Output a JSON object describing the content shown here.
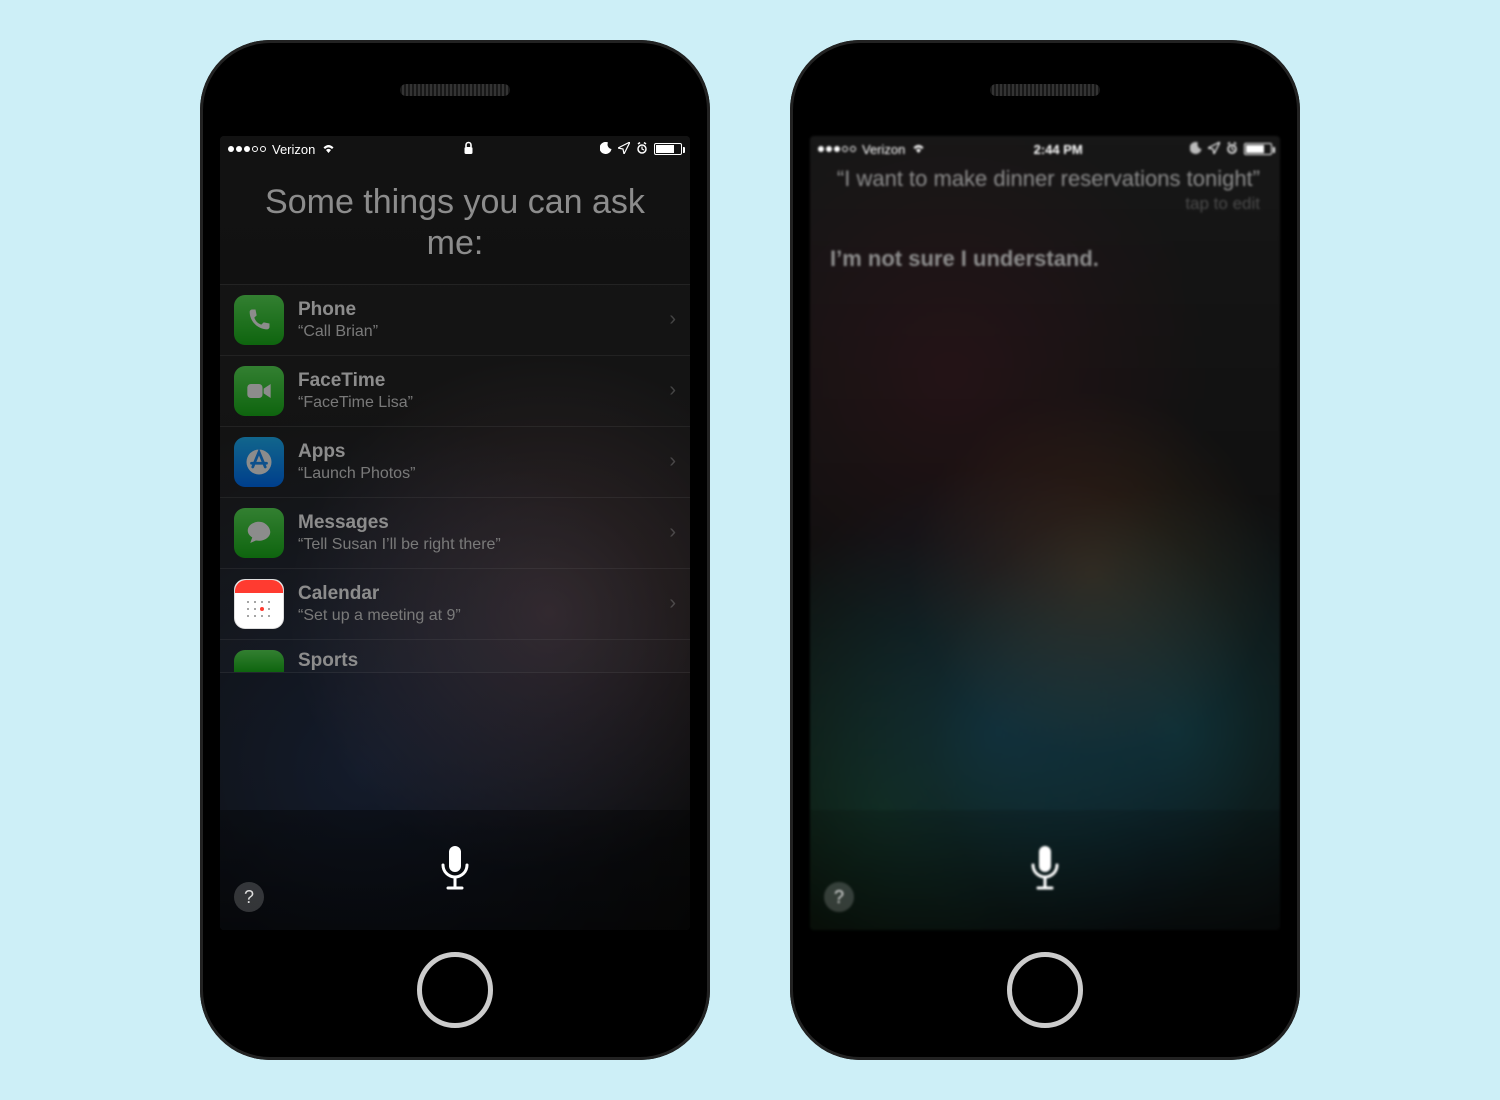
{
  "phone1": {
    "status": {
      "carrier": "Verizon",
      "time": ""
    },
    "title": "Some things you can ask me:",
    "items": [
      {
        "icon": "phone",
        "title": "Phone",
        "example": "“Call Brian”"
      },
      {
        "icon": "facetime",
        "title": "FaceTime",
        "example": "“FaceTime Lisa”"
      },
      {
        "icon": "apps",
        "title": "Apps",
        "example": "“Launch Photos”"
      },
      {
        "icon": "messages",
        "title": "Messages",
        "example": "“Tell Susan I’ll be right there”"
      },
      {
        "icon": "calendar",
        "title": "Calendar",
        "example": "“Set up a meeting at 9”"
      },
      {
        "icon": "sports",
        "title": "Sports",
        "example": ""
      }
    ]
  },
  "phone2": {
    "status": {
      "carrier": "Verizon",
      "time": "2:44 PM"
    },
    "query": "“I want to make dinner reservations tonight”",
    "tap_edit": "tap to edit",
    "response": "I’m not sure I understand."
  },
  "help_label": "?"
}
